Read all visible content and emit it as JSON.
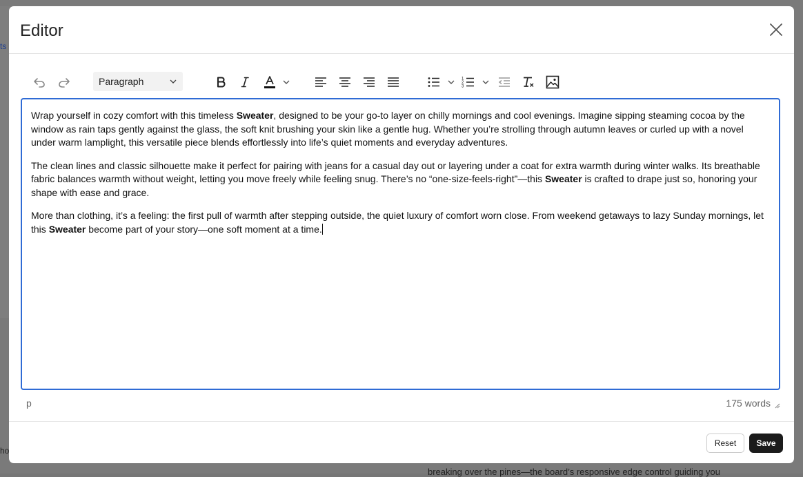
{
  "background": {
    "link_fragment": "ts",
    "left_fragment": "ho",
    "bottom_fragment": "breaking over the pines—the board’s responsive edge control guiding you"
  },
  "modal": {
    "title": "Editor",
    "close_icon": "close-icon"
  },
  "toolbar": {
    "undo_icon": "undo-icon",
    "redo_icon": "redo-icon",
    "block_format": "Paragraph",
    "bold_icon": "bold-icon",
    "italic_icon": "italic-icon",
    "text_color_icon": "text-color-icon",
    "text_color": "#111111",
    "align_icons": [
      "align-left-icon",
      "align-center-icon",
      "align-right-icon",
      "align-justify-icon"
    ],
    "list_icons": [
      "bullet-list-icon",
      "numbered-list-icon",
      "outdent-icon"
    ],
    "clear_format_icon": "clear-formatting-icon",
    "image_icon": "image-icon"
  },
  "content": {
    "p1": {
      "a": "Wrap yourself in cozy comfort with this timeless ",
      "b": "Sweater",
      "c": ", designed to be your go-to layer on chilly mornings and cool evenings. Imagine sipping steaming cocoa by the window as rain taps gently against the glass, the soft knit brushing your skin like a gentle hug. Whether you’re strolling through autumn leaves or curled up with a novel under warm lamplight, this versatile piece blends effortlessly into life’s quiet moments and everyday adventures."
    },
    "p2": {
      "a": "The clean lines and classic silhouette make it perfect for pairing with jeans for a casual day out or layering under a coat for extra warmth during winter walks. Its breathable fabric balances warmth without weight, letting you move freely while feeling snug. There’s no “one-size-feels-right”—this ",
      "b": "Sweater",
      "c": " is crafted to drape just so, honoring your shape with ease and grace."
    },
    "p3": {
      "a": "More than clothing, it’s a feeling: the first pull of warmth after stepping outside, the quiet luxury of comfort worn close. From weekend getaways to lazy Sunday mornings, let this ",
      "b": "Sweater",
      "c": " become part of your story—one soft moment at a time."
    }
  },
  "status": {
    "path": "p",
    "word_count": "175 words"
  },
  "footer": {
    "reset_label": "Reset",
    "save_label": "Save"
  },
  "colors": {
    "focus_border": "#2f6bd5",
    "save_bg": "#1b1b1b"
  }
}
